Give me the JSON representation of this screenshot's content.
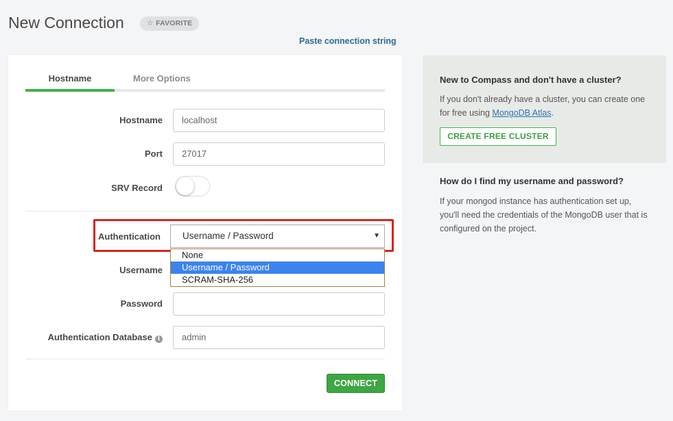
{
  "header": {
    "title": "New Connection",
    "favorite_label": "FAVORITE",
    "paste_link": "Paste connection string"
  },
  "tabs": [
    {
      "label": "Hostname",
      "active": true
    },
    {
      "label": "More Options",
      "active": false
    }
  ],
  "form": {
    "hostname": {
      "label": "Hostname",
      "value": "localhost"
    },
    "port": {
      "label": "Port",
      "value": "27017"
    },
    "srv": {
      "label": "SRV Record",
      "enabled": false
    },
    "authentication": {
      "label": "Authentication",
      "selected": "Username / Password",
      "options": [
        "None",
        "Username / Password",
        "SCRAM-SHA-256"
      ]
    },
    "username": {
      "label": "Username",
      "value": ""
    },
    "password": {
      "label": "Password",
      "value": ""
    },
    "auth_db": {
      "label": "Authentication Database",
      "value": "admin"
    },
    "connect_label": "CONNECT"
  },
  "sidebar": {
    "cluster_title": "New to Compass and don't have a cluster?",
    "cluster_text_before": "If you don't already have a cluster, you can create one for free using ",
    "atlas_link": "MongoDB Atlas",
    "cluster_text_after": ".",
    "create_cluster_label": "CREATE FREE CLUSTER",
    "credentials_title": "How do I find my username and password?",
    "credentials_text": "If your mongod instance has authentication set up, you'll need the credentials of the MongoDB user that is configured on the project."
  },
  "colors": {
    "accent_green": "#43b14a",
    "link_blue": "#2a75b5",
    "highlight_red": "#d9251c",
    "dropdown_selected": "#3b83f0"
  }
}
